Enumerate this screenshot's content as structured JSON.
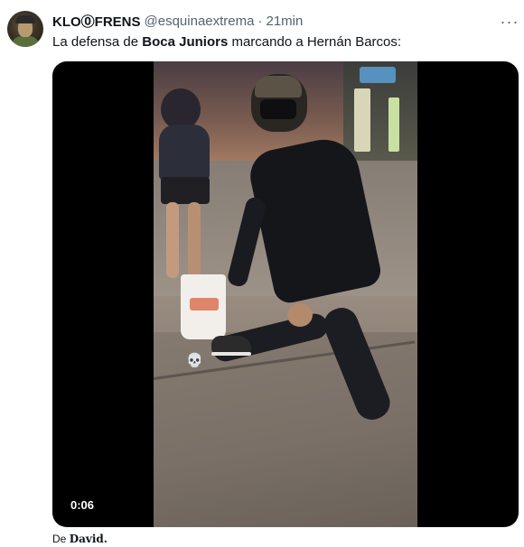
{
  "tweet": {
    "author": {
      "display_name": "KLO⓪FRENS",
      "handle": "@esquinaextrema",
      "separator": "·",
      "time": "21min"
    },
    "more_icon": "ellipsis-icon",
    "more_label": "···",
    "text": {
      "part1": "La defensa de ",
      "bold1": "Boca Juniors",
      "part2": " marcando a Hernán Barcos:"
    },
    "media": {
      "type": "video",
      "duration": "0:06",
      "overlay_emoji": "💀"
    },
    "attribution": {
      "prefix": "De ",
      "name": "David."
    }
  },
  "colors": {
    "primary_text": "#0f1419",
    "secondary_text": "#536471",
    "media_background": "#000000"
  }
}
